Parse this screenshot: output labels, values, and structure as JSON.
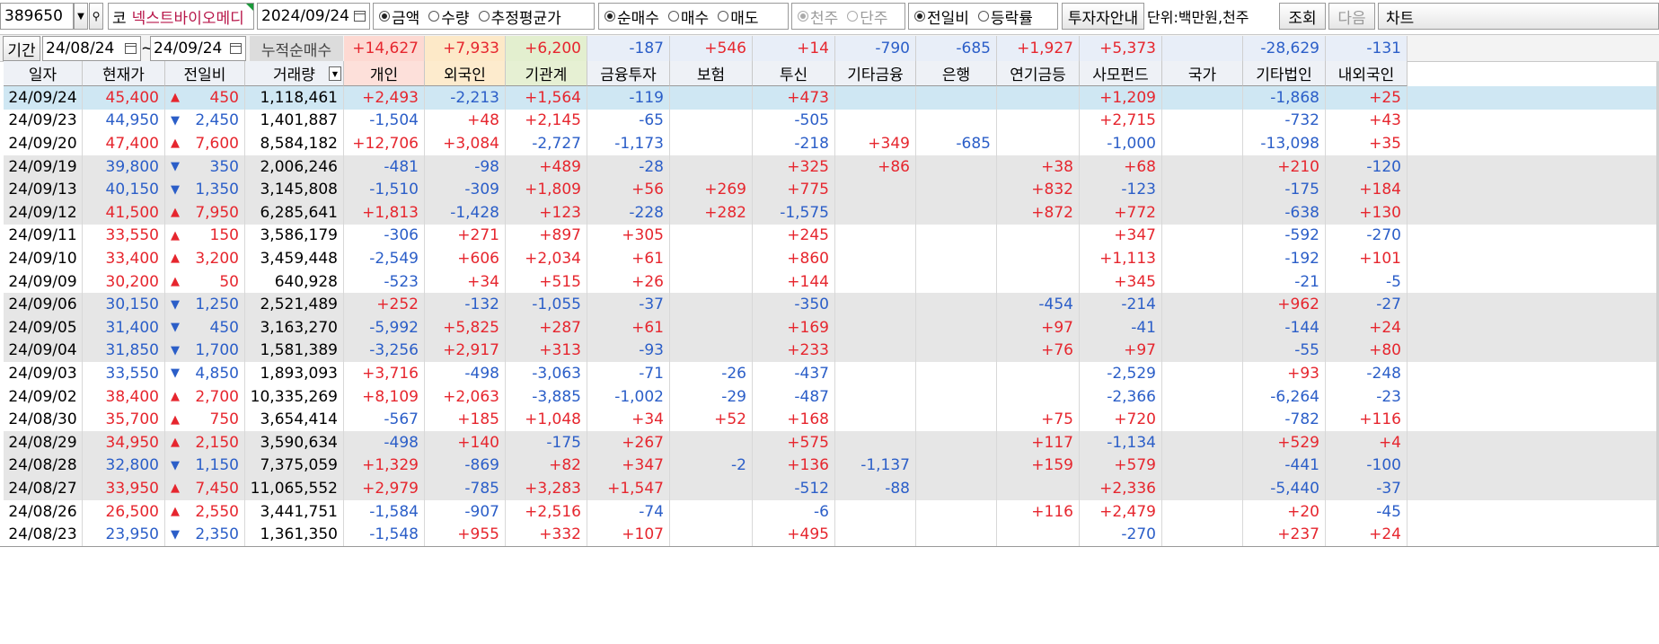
{
  "toolbar": {
    "code": "389650",
    "market": "코",
    "stock_name": "넥스트바이오메디",
    "date": "2024/09/24",
    "radio_group1": [
      {
        "label": "금액",
        "on": true
      },
      {
        "label": "수량",
        "on": false
      },
      {
        "label": "추정평균가",
        "on": false
      }
    ],
    "radio_group2": [
      {
        "label": "순매수",
        "on": true
      },
      {
        "label": "매수",
        "on": false
      },
      {
        "label": "매도",
        "on": false
      }
    ],
    "radio_group3": [
      {
        "label": "천주",
        "on": true
      },
      {
        "label": "단주",
        "on": false
      }
    ],
    "radio_group4": [
      {
        "label": "전일비",
        "on": true
      },
      {
        "label": "등락률",
        "on": false
      }
    ],
    "investor_info_button": "투자자안내",
    "unit_text": "단위:백만원,천주",
    "query_button": "조회",
    "next_button": "다음",
    "chart_button": "차트"
  },
  "period": {
    "label": "기간",
    "from": "24/08/24",
    "tilde": "~",
    "to": "24/09/24",
    "cumulative_label": "누적순매수"
  },
  "summary": [
    "+14,627",
    "+7,933",
    "+6,200",
    "-187",
    "+546",
    "+14",
    "-790",
    "-685",
    "+1,927",
    "+5,373",
    "",
    "-28,629",
    "-131"
  ],
  "headers": [
    "일자",
    "현재가",
    "전일비",
    "거래량",
    "개인",
    "외국인",
    "기관계",
    "금융투자",
    "보험",
    "투신",
    "기타금융",
    "은행",
    "연기금등",
    "사모펀드",
    "국가",
    "기타법인",
    "내외국인"
  ],
  "rows": [
    {
      "date": "24/09/24",
      "price": "45,400",
      "dir": "up",
      "change": "450",
      "volume": "1,118,461",
      "vals": [
        "+2,493",
        "-2,213",
        "+1,564",
        "-119",
        "",
        "+473",
        "",
        "",
        "",
        "+1,209",
        "",
        "-1,868",
        "+25"
      ]
    },
    {
      "date": "24/09/23",
      "price": "44,950",
      "dir": "down",
      "change": "2,450",
      "volume": "1,401,887",
      "vals": [
        "-1,504",
        "+48",
        "+2,145",
        "-65",
        "",
        "-505",
        "",
        "",
        "",
        "+2,715",
        "",
        "-732",
        "+43"
      ]
    },
    {
      "date": "24/09/20",
      "price": "47,400",
      "dir": "up",
      "change": "7,600",
      "volume": "8,584,182",
      "vals": [
        "+12,706",
        "+3,084",
        "-2,727",
        "-1,173",
        "",
        "-218",
        "+349",
        "-685",
        "",
        "-1,000",
        "",
        "-13,098",
        "+35"
      ]
    },
    {
      "date": "24/09/19",
      "price": "39,800",
      "dir": "down",
      "change": "350",
      "volume": "2,006,246",
      "vals": [
        "-481",
        "-98",
        "+489",
        "-28",
        "",
        "+325",
        "+86",
        "",
        "+38",
        "+68",
        "",
        "+210",
        "-120"
      ]
    },
    {
      "date": "24/09/13",
      "price": "40,150",
      "dir": "down",
      "change": "1,350",
      "volume": "3,145,808",
      "vals": [
        "-1,510",
        "-309",
        "+1,809",
        "+56",
        "+269",
        "+775",
        "",
        "",
        "+832",
        "-123",
        "",
        "-175",
        "+184"
      ]
    },
    {
      "date": "24/09/12",
      "price": "41,500",
      "dir": "up",
      "change": "7,950",
      "volume": "6,285,641",
      "vals": [
        "+1,813",
        "-1,428",
        "+123",
        "-228",
        "+282",
        "-1,575",
        "",
        "",
        "+872",
        "+772",
        "",
        "-638",
        "+130"
      ]
    },
    {
      "date": "24/09/11",
      "price": "33,550",
      "dir": "up",
      "change": "150",
      "volume": "3,586,179",
      "vals": [
        "-306",
        "+271",
        "+897",
        "+305",
        "",
        "+245",
        "",
        "",
        "",
        "+347",
        "",
        "-592",
        "-270"
      ]
    },
    {
      "date": "24/09/10",
      "price": "33,400",
      "dir": "up",
      "change": "3,200",
      "volume": "3,459,448",
      "vals": [
        "-2,549",
        "+606",
        "+2,034",
        "+61",
        "",
        "+860",
        "",
        "",
        "",
        "+1,113",
        "",
        "-192",
        "+101"
      ]
    },
    {
      "date": "24/09/09",
      "price": "30,200",
      "dir": "up",
      "change": "50",
      "volume": "640,928",
      "vals": [
        "-523",
        "+34",
        "+515",
        "+26",
        "",
        "+144",
        "",
        "",
        "",
        "+345",
        "",
        "-21",
        "-5"
      ]
    },
    {
      "date": "24/09/06",
      "price": "30,150",
      "dir": "down",
      "change": "1,250",
      "volume": "2,521,489",
      "vals": [
        "+252",
        "-132",
        "-1,055",
        "-37",
        "",
        "-350",
        "",
        "",
        "-454",
        "-214",
        "",
        "+962",
        "-27"
      ]
    },
    {
      "date": "24/09/05",
      "price": "31,400",
      "dir": "down",
      "change": "450",
      "volume": "3,163,270",
      "vals": [
        "-5,992",
        "+5,825",
        "+287",
        "+61",
        "",
        "+169",
        "",
        "",
        "+97",
        "-41",
        "",
        "-144",
        "+24"
      ]
    },
    {
      "date": "24/09/04",
      "price": "31,850",
      "dir": "down",
      "change": "1,700",
      "volume": "1,581,389",
      "vals": [
        "-3,256",
        "+2,917",
        "+313",
        "-93",
        "",
        "+233",
        "",
        "",
        "+76",
        "+97",
        "",
        "-55",
        "+80"
      ]
    },
    {
      "date": "24/09/03",
      "price": "33,550",
      "dir": "down",
      "change": "4,850",
      "volume": "1,893,093",
      "vals": [
        "+3,716",
        "-498",
        "-3,063",
        "-71",
        "-26",
        "-437",
        "",
        "",
        "",
        "-2,529",
        "",
        "+93",
        "-248"
      ]
    },
    {
      "date": "24/09/02",
      "price": "38,400",
      "dir": "up",
      "change": "2,700",
      "volume": "10,335,269",
      "vals": [
        "+8,109",
        "+2,063",
        "-3,885",
        "-1,002",
        "-29",
        "-487",
        "",
        "",
        "",
        "-2,366",
        "",
        "-6,264",
        "-23"
      ]
    },
    {
      "date": "24/08/30",
      "price": "35,700",
      "dir": "up",
      "change": "750",
      "volume": "3,654,414",
      "vals": [
        "-567",
        "+185",
        "+1,048",
        "+34",
        "+52",
        "+168",
        "",
        "",
        "+75",
        "+720",
        "",
        "-782",
        "+116"
      ]
    },
    {
      "date": "24/08/29",
      "price": "34,950",
      "dir": "up",
      "change": "2,150",
      "volume": "3,590,634",
      "vals": [
        "-498",
        "+140",
        "-175",
        "+267",
        "",
        "+575",
        "",
        "",
        "+117",
        "-1,134",
        "",
        "+529",
        "+4"
      ]
    },
    {
      "date": "24/08/28",
      "price": "32,800",
      "dir": "down",
      "change": "1,150",
      "volume": "7,375,059",
      "vals": [
        "+1,329",
        "-869",
        "+82",
        "+347",
        "-2",
        "+136",
        "-1,137",
        "",
        "+159",
        "+579",
        "",
        "-441",
        "-100"
      ]
    },
    {
      "date": "24/08/27",
      "price": "33,950",
      "dir": "up",
      "change": "7,450",
      "volume": "11,065,552",
      "vals": [
        "+2,979",
        "-785",
        "+3,283",
        "+1,547",
        "",
        "-512",
        "-88",
        "",
        "",
        "+2,336",
        "",
        "-5,440",
        "-37"
      ]
    },
    {
      "date": "24/08/26",
      "price": "26,500",
      "dir": "up",
      "change": "2,550",
      "volume": "3,441,751",
      "vals": [
        "-1,584",
        "-907",
        "+2,516",
        "-74",
        "",
        "-6",
        "",
        "",
        "+116",
        "+2,479",
        "",
        "+20",
        "-45"
      ]
    },
    {
      "date": "24/08/23",
      "price": "23,950",
      "dir": "down",
      "change": "2,350",
      "volume": "1,361,350",
      "vals": [
        "-1,548",
        "+955",
        "+332",
        "+107",
        "",
        "+495",
        "",
        "",
        "",
        "-270",
        "",
        "+237",
        "+24"
      ]
    }
  ],
  "colors": {
    "positive": "#e6262e",
    "negative": "#2b5ec8",
    "selected_row": "#cfe7f3",
    "shaded_row": "#e6e6e6",
    "summary_bg": "#e8eef8",
    "summary_personal": "#fdd9d2",
    "summary_foreign": "#fde9c8",
    "summary_inst": "#e3efcf",
    "header_personal": "#fde0da",
    "header_foreign": "#fdebcd",
    "header_inst": "#e6f0d3"
  },
  "icons": {
    "dropdown": "chevron-down-icon",
    "calendar": "calendar-icon",
    "sort": "sort-down-icon"
  }
}
